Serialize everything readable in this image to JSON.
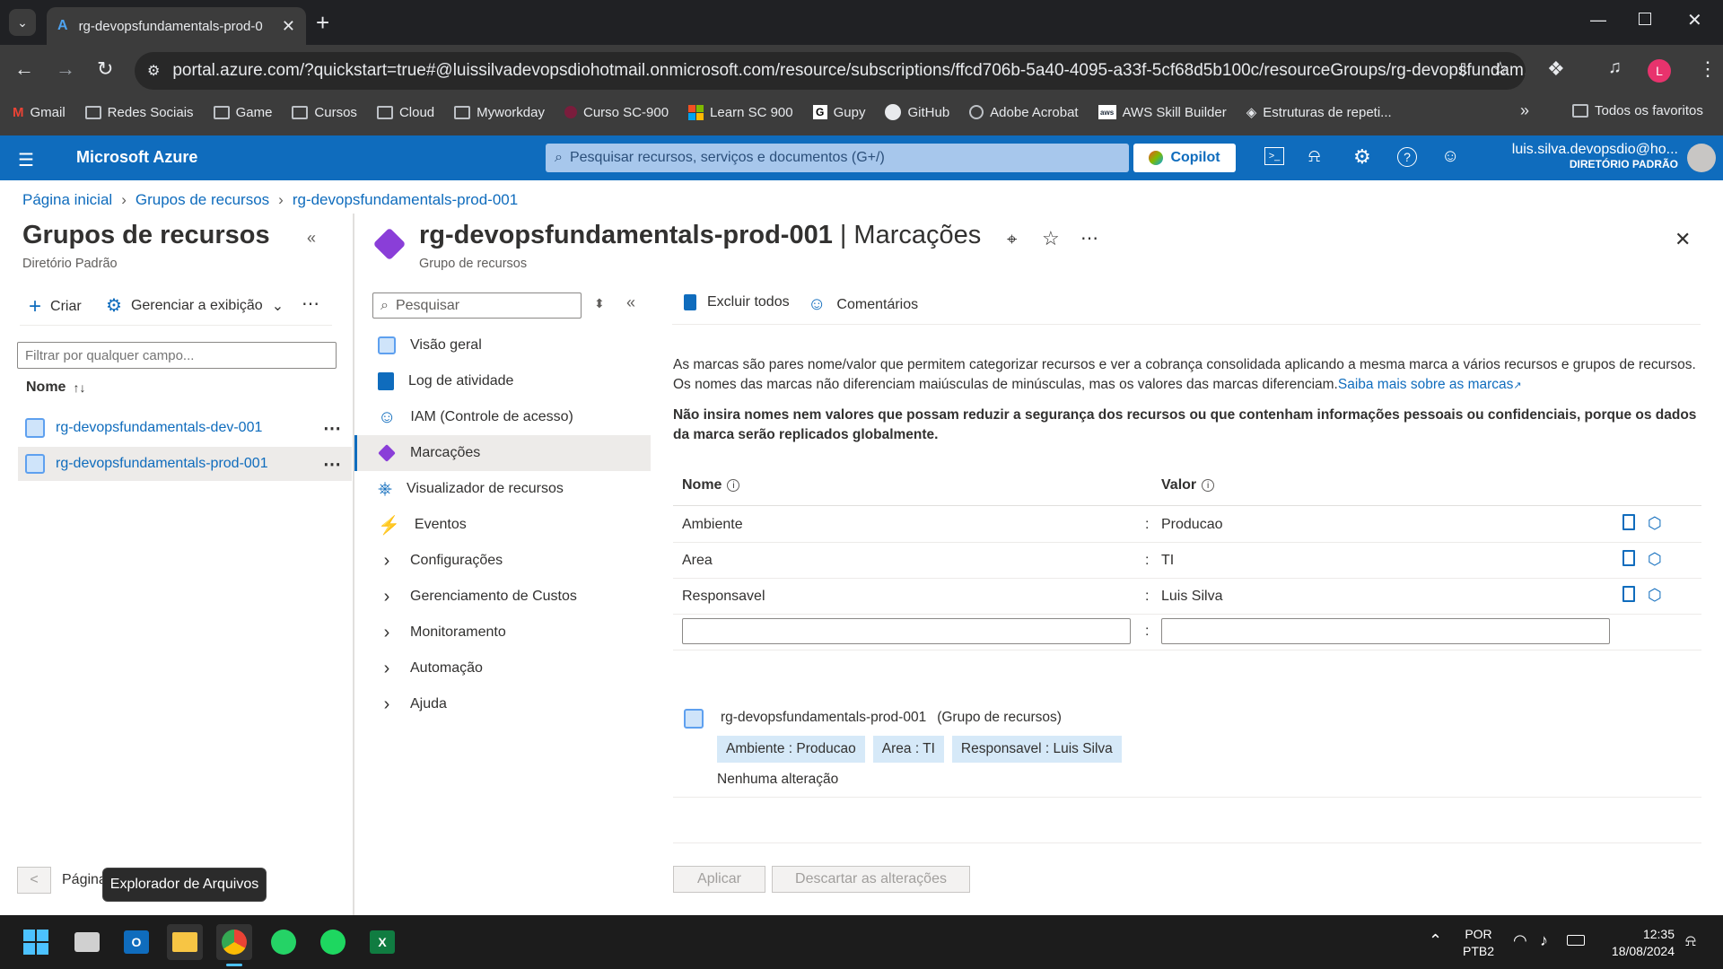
{
  "browser": {
    "tab_title": "rg-devopsfundamentals-prod-0",
    "url": "portal.azure.com/?quickstart=true#@luissilvadevopsdiohotmail.onmicrosoft.com/resource/subscriptions/ffcd706b-5a40-4095-a33f-5cf68d5b100c/resourceGroups/rg-devopsfundam...",
    "profile_initial": "L",
    "bookmarks": [
      "Gmail",
      "Redes Sociais",
      "Game",
      "Cursos",
      "Cloud",
      "Myworkday",
      "Curso SC-900",
      "Learn SC 900",
      "Gupy",
      "GitHub",
      "Adobe Acrobat",
      "AWS Skill Builder",
      "Estruturas de repeti..."
    ],
    "all_bookmarks": "Todos os favoritos"
  },
  "azure": {
    "brand": "Microsoft Azure",
    "search_placeholder": "Pesquisar recursos, serviços e documentos (G+/)",
    "copilot": "Copilot",
    "user_name": "luis.silva.devopsdio@ho...",
    "user_dir": "DIRETÓRIO PADRÃO"
  },
  "breadcrumb": [
    "Página inicial",
    "Grupos de recursos",
    "rg-devopsfundamentals-prod-001"
  ],
  "left_panel": {
    "title": "Grupos de recursos",
    "subtitle": "Diretório Padrão",
    "create": "Criar",
    "manage_view": "Gerenciar a exibição",
    "filter_placeholder": "Filtrar por qualquer campo...",
    "col_name": "Nome",
    "items": [
      "rg-devopsfundamentals-dev-001",
      "rg-devopsfundamentals-prod-001"
    ],
    "pager_label": "Página"
  },
  "blade": {
    "title": "rg-devopsfundamentals-prod-001",
    "title_section": "| Marcações",
    "subtitle": "Grupo de recursos",
    "menu_search_placeholder": "Pesquisar",
    "menu": [
      {
        "label": "Visão geral"
      },
      {
        "label": "Log de atividade"
      },
      {
        "label": "IAM (Controle de acesso)"
      },
      {
        "label": "Marcações"
      },
      {
        "label": "Visualizador de recursos"
      },
      {
        "label": "Eventos"
      },
      {
        "label": "Configurações"
      },
      {
        "label": "Gerenciamento de Custos"
      },
      {
        "label": "Monitoramento"
      },
      {
        "label": "Automação"
      },
      {
        "label": "Ajuda"
      }
    ],
    "cmd_delete_all": "Excluir todos",
    "cmd_feedback": "Comentários",
    "description": "As marcas são pares nome/valor que permitem categorizar recursos e ver a cobrança consolidada aplicando a mesma marca a vários recursos e grupos de recursos. Os nomes das marcas não diferenciam maiúsculas de minúsculas, mas os valores das marcas diferenciam.",
    "learn_more": "Saiba mais sobre as marcas",
    "warning": "Não insira nomes nem valores que possam reduzir a segurança dos recursos ou que contenham informações pessoais ou confidenciais, porque os dados da marca serão replicados globalmente.",
    "col_name": "Nome",
    "col_value": "Valor",
    "tags": [
      {
        "name": "Ambiente",
        "value": "Producao"
      },
      {
        "name": "Area",
        "value": "TI"
      },
      {
        "name": "Responsavel",
        "value": "Luis Silva"
      }
    ],
    "summary_resource": "rg-devopsfundamentals-prod-001",
    "summary_type": "(Grupo de recursos)",
    "chips": [
      "Ambiente : Producao",
      "Area : TI",
      "Responsavel : Luis Silva"
    ],
    "no_change": "Nenhuma alteração",
    "apply": "Aplicar",
    "discard": "Descartar as alterações"
  },
  "taskbar": {
    "tooltip": "Explorador de Arquivos",
    "lang1": "POR",
    "lang2": "PTB2",
    "time": "12:35",
    "date": "18/08/2024"
  }
}
